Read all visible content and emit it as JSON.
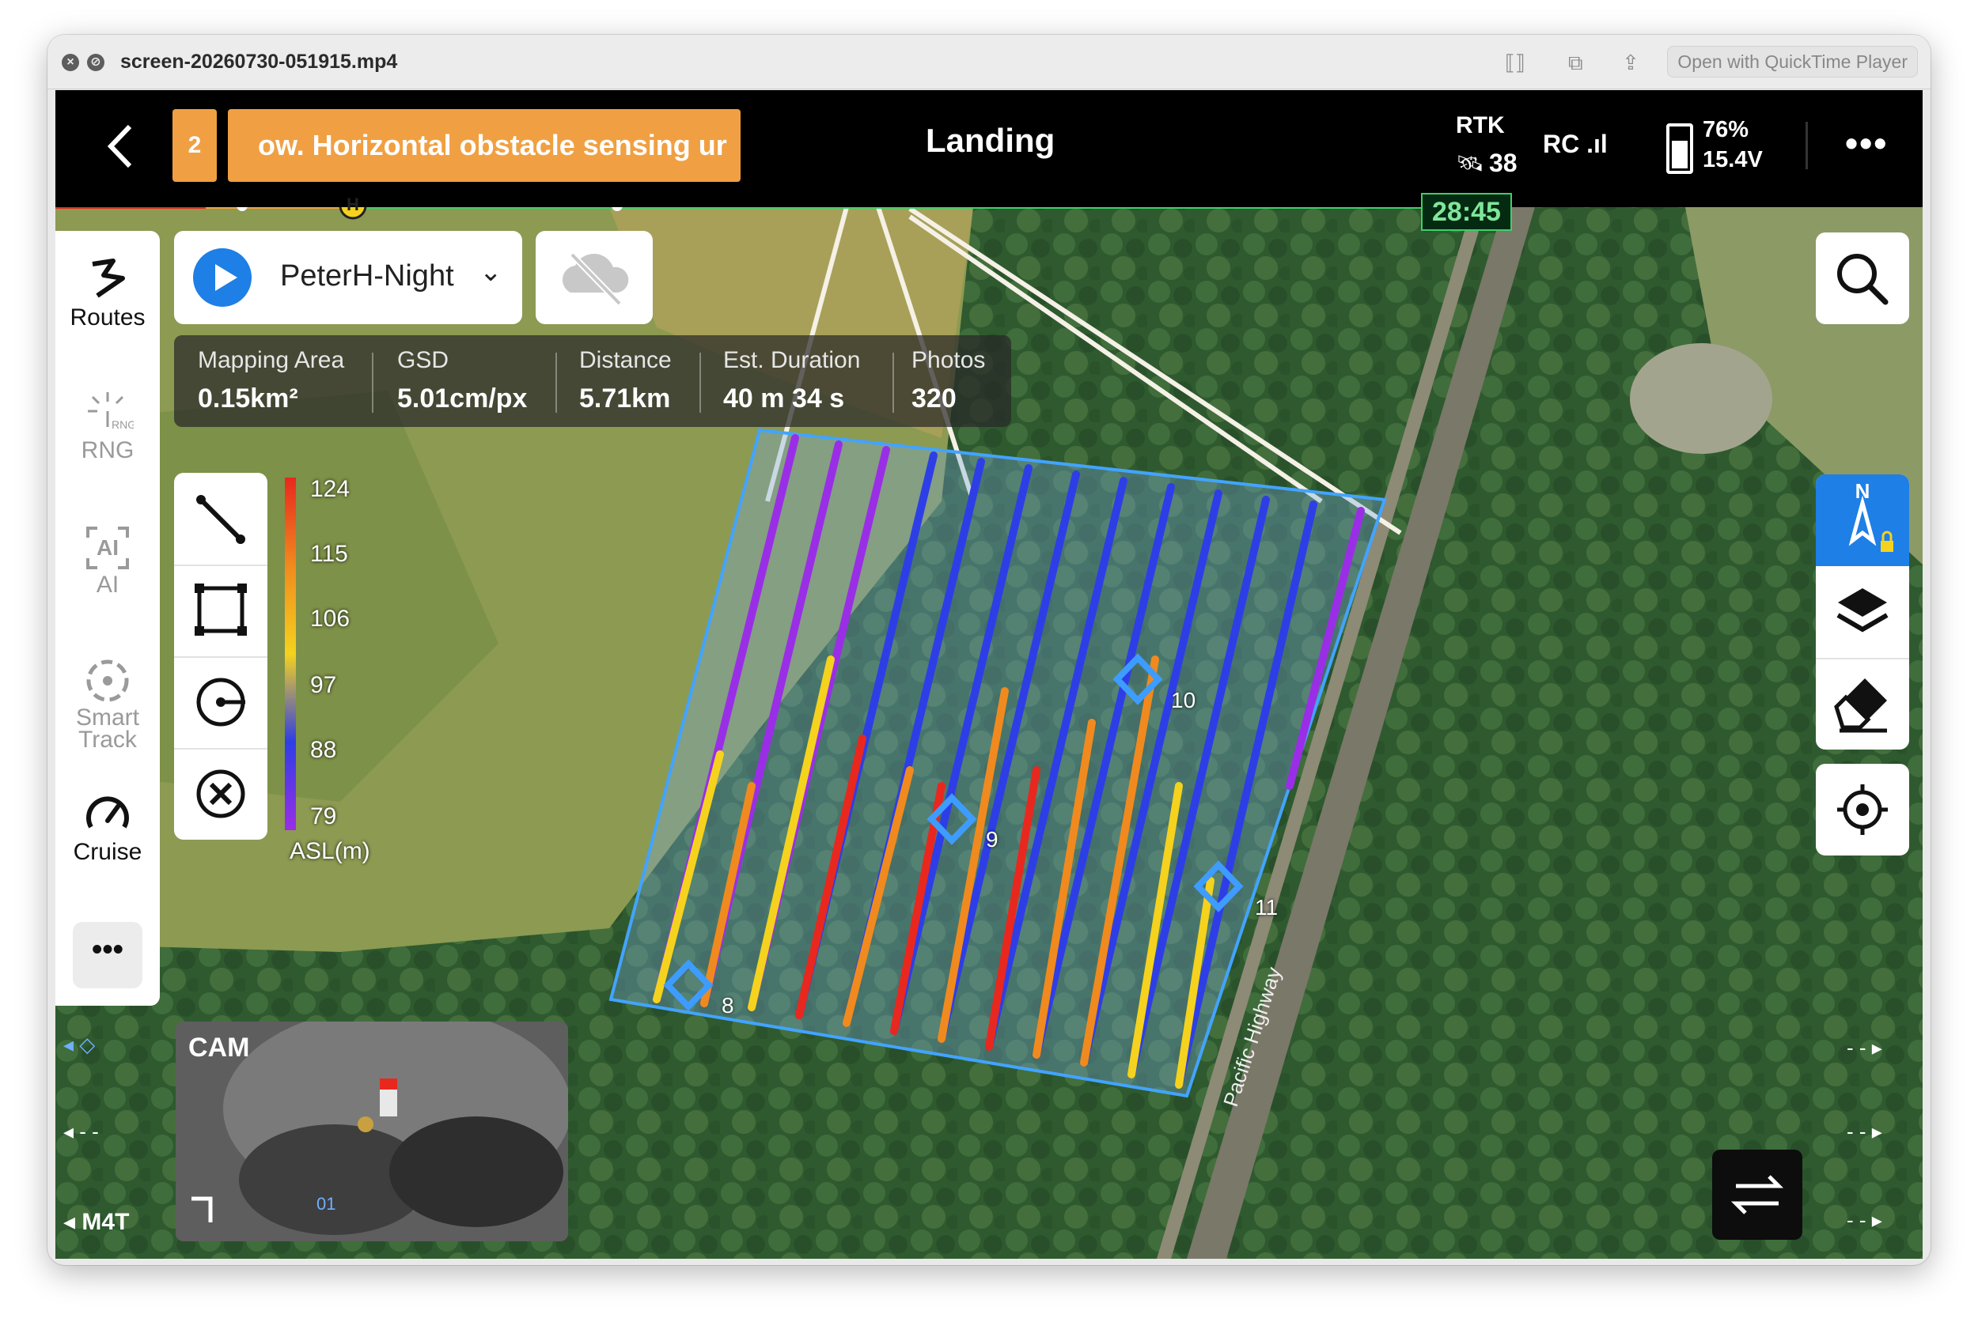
{
  "window": {
    "title": "screen-20260730-051915.mp4",
    "quicktime_button": "Open with QuickTime Player"
  },
  "topbar": {
    "warning_count": "2",
    "warning_text": "ow. Horizontal obstacle sensing ur",
    "flight_mode": "Landing",
    "rtk_label": "RTK",
    "rtk_satellites": "38",
    "rc_label": "RC",
    "battery_percent": "76%",
    "battery_voltage": "15.4V",
    "battery_level": 0.76,
    "timer": "28:45",
    "progress_marker": "H"
  },
  "sidebar": {
    "items": [
      {
        "label": "Routes",
        "icon": "routes-icon",
        "active": true
      },
      {
        "label": "RNG",
        "icon": "rng-icon",
        "active": false,
        "icon_text": "RNG"
      },
      {
        "label": "AI",
        "icon": "ai-icon",
        "active": false,
        "icon_text": "AI"
      },
      {
        "label": "Smart\nTrack",
        "label_lines": [
          "Smart",
          "Track"
        ],
        "icon": "smart-track-icon",
        "active": false
      },
      {
        "label": "Cruise",
        "icon": "cruise-icon",
        "active": true
      }
    ],
    "more_label": "•••"
  },
  "route": {
    "name": "PeterH-Night"
  },
  "stats": [
    {
      "key": "Mapping Area",
      "value": "0.15km²"
    },
    {
      "key": "GSD",
      "value": "5.01cm/px"
    },
    {
      "key": "Distance",
      "value": "5.71km"
    },
    {
      "key": "Est. Duration",
      "value": "40 m 34 s"
    },
    {
      "key": "Photos",
      "value": "320"
    }
  ],
  "legend": {
    "labels": [
      "124",
      "115",
      "106",
      "97",
      "88",
      "79"
    ],
    "unit": "ASL(m)",
    "colors": [
      "#e8281e",
      "#f08a1e",
      "#f5d21e",
      "#2e3ee6",
      "#9a2ee6"
    ]
  },
  "waypoints": [
    "8",
    "9",
    "10",
    "11"
  ],
  "map": {
    "road_label": "Pacific Highway"
  },
  "camera": {
    "label": "CAM",
    "channel": "01"
  },
  "bottom_left": {
    "model": "M4T",
    "dash1": "- -",
    "dash2": "- -"
  },
  "right_side": {
    "dash": "- -",
    "compass_label": "N"
  }
}
